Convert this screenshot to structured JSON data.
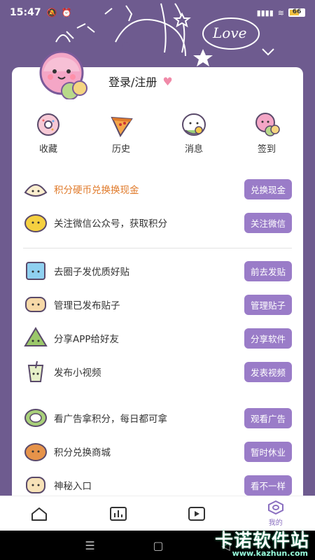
{
  "status": {
    "time": "15:47",
    "battery": "66"
  },
  "profile": {
    "login_label": "登录/注册"
  },
  "quick_actions": [
    {
      "label": "收藏",
      "icon": "donut-icon"
    },
    {
      "label": "历史",
      "icon": "pizza-icon"
    },
    {
      "label": "消息",
      "icon": "rice-ball-icon"
    },
    {
      "label": "签到",
      "icon": "mochi-icon"
    }
  ],
  "section1": [
    {
      "text": "积分硬币兑换换现金",
      "button": "兑换现金",
      "highlight": true
    },
    {
      "text": "关注微信公众号，获取积分",
      "button": "关注微信"
    }
  ],
  "section2": [
    {
      "text": "去圈子发优质好贴",
      "button": "前去发贴"
    },
    {
      "text": "管理已发布贴子",
      "button": "管理贴子"
    },
    {
      "text": "分享APP给好友",
      "button": "分享软件"
    },
    {
      "text": "发布小视频",
      "button": "发表视频"
    }
  ],
  "section3": [
    {
      "text": "看广告拿积分，每日都可拿",
      "button": "观看广告"
    },
    {
      "text": "积分兑换商城",
      "button": "暂时休业"
    },
    {
      "text": "神秘入口",
      "button": "看不一样"
    }
  ],
  "nav": {
    "mine_label": "我的"
  },
  "watermark": {
    "main": "卡诺软件站",
    "sub": "www.kazhun.com"
  },
  "colors": {
    "accent": "#9a7cc8",
    "background": "#6e5b8f",
    "highlight_text": "#e07a2a"
  }
}
